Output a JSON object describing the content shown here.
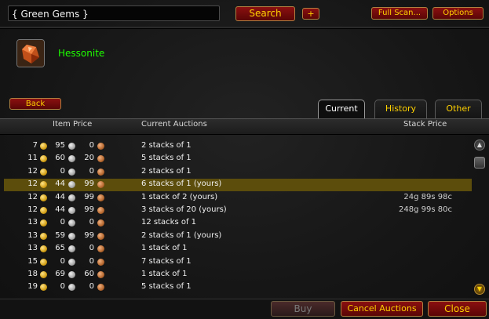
{
  "search": {
    "value": "{ Green Gems }"
  },
  "toolbar": {
    "search_label": "Search",
    "plus_label": "+",
    "fullscan_label": "Full Scan...",
    "options_label": "Options"
  },
  "item": {
    "name": "Hessonite",
    "name_color": "#1eff00",
    "icon": "gem-icon"
  },
  "back_label": "Back",
  "tabs": [
    {
      "label": "Current",
      "active": true
    },
    {
      "label": "History",
      "active": false
    },
    {
      "label": "Other",
      "active": false
    }
  ],
  "columns": {
    "item_price": "Item Price",
    "current_auctions": "Current Auctions",
    "stack_price": "Stack Price"
  },
  "rows": [
    {
      "gold": "7",
      "silver": "95",
      "copper": "0",
      "auctions": "2 stacks of 1",
      "stack_price": "",
      "selected": false
    },
    {
      "gold": "11",
      "silver": "60",
      "copper": "20",
      "auctions": "5 stacks of 1",
      "stack_price": "",
      "selected": false
    },
    {
      "gold": "12",
      "silver": "0",
      "copper": "0",
      "auctions": "2 stacks of 1",
      "stack_price": "",
      "selected": false
    },
    {
      "gold": "12",
      "silver": "44",
      "copper": "99",
      "auctions": "6 stacks of 1 (yours)",
      "stack_price": "",
      "selected": true
    },
    {
      "gold": "12",
      "silver": "44",
      "copper": "99",
      "auctions": "1 stack of 2 (yours)",
      "stack_price": "24g 89s 98c",
      "selected": false
    },
    {
      "gold": "12",
      "silver": "44",
      "copper": "99",
      "auctions": "3 stacks of 20 (yours)",
      "stack_price": "248g 99s 80c",
      "selected": false
    },
    {
      "gold": "13",
      "silver": "0",
      "copper": "0",
      "auctions": "12 stacks of 1",
      "stack_price": "",
      "selected": false
    },
    {
      "gold": "13",
      "silver": "59",
      "copper": "99",
      "auctions": "2 stacks of 1 (yours)",
      "stack_price": "",
      "selected": false
    },
    {
      "gold": "13",
      "silver": "65",
      "copper": "0",
      "auctions": "1 stack of 1",
      "stack_price": "",
      "selected": false
    },
    {
      "gold": "15",
      "silver": "0",
      "copper": "0",
      "auctions": "7 stacks of 1",
      "stack_price": "",
      "selected": false
    },
    {
      "gold": "18",
      "silver": "69",
      "copper": "60",
      "auctions": "1 stack of 1",
      "stack_price": "",
      "selected": false
    },
    {
      "gold": "19",
      "silver": "0",
      "copper": "0",
      "auctions": "5 stacks of 1",
      "stack_price": "",
      "selected": false
    }
  ],
  "footer": {
    "buy_label": "Buy",
    "cancel_label": "Cancel Auctions",
    "close_label": "Close"
  },
  "colors": {
    "gold_text": "#ffd100",
    "selected_row": "#5c4d0c",
    "button_red": "#8a1010"
  }
}
